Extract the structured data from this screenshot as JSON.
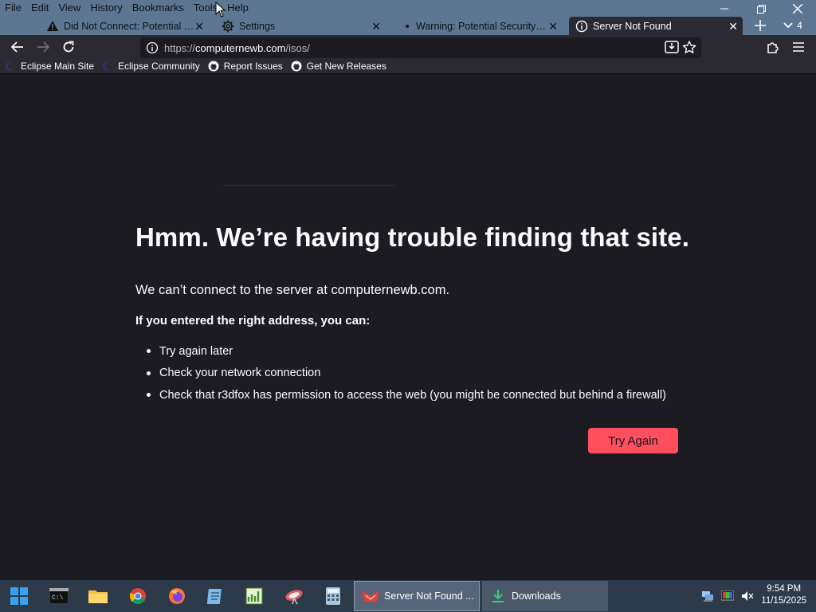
{
  "menubar": {
    "items": [
      "File",
      "Edit",
      "View",
      "History",
      "Bookmarks",
      "Tools",
      "Help"
    ]
  },
  "tabs": [
    {
      "title": "Did Not Connect: Potential Sec",
      "icon": "warning-icon"
    },
    {
      "title": "Settings",
      "icon": "gear-icon"
    },
    {
      "title": "Warning: Potential Security Risk",
      "icon": "dot-icon"
    },
    {
      "title": "Server Not Found",
      "icon": "info-icon",
      "active": true
    }
  ],
  "tab_count": "4",
  "nav": {
    "url_prefix": "https://",
    "url_host": "computernewb.com",
    "url_path": "/isos/"
  },
  "bookmarks": [
    "Eclipse Main Site",
    "Eclipse Community",
    "Report Issues",
    "Get New Releases"
  ],
  "error": {
    "title": "Hmm. We’re having trouble finding that site.",
    "message": "We can’t connect to the server at computernewb.com.",
    "subheading": "If you entered the right address, you can:",
    "suggestions": [
      "Try again later",
      "Check your network connection",
      "Check that r3dfox has permission to access the web (you might be connected but behind a firewall)"
    ],
    "button": "Try Again"
  },
  "taskbar": {
    "apps": [
      {
        "label": "Server Not Found ...",
        "active": true
      },
      {
        "label": "Downloads",
        "active": false
      }
    ],
    "time": "9:54 PM",
    "date": "11/15/2025"
  },
  "colors": {
    "accent": "#ff4f5e",
    "titlebar": "#5d7793",
    "page_bg": "#1c1b22",
    "toolbar": "#2b2a33"
  }
}
